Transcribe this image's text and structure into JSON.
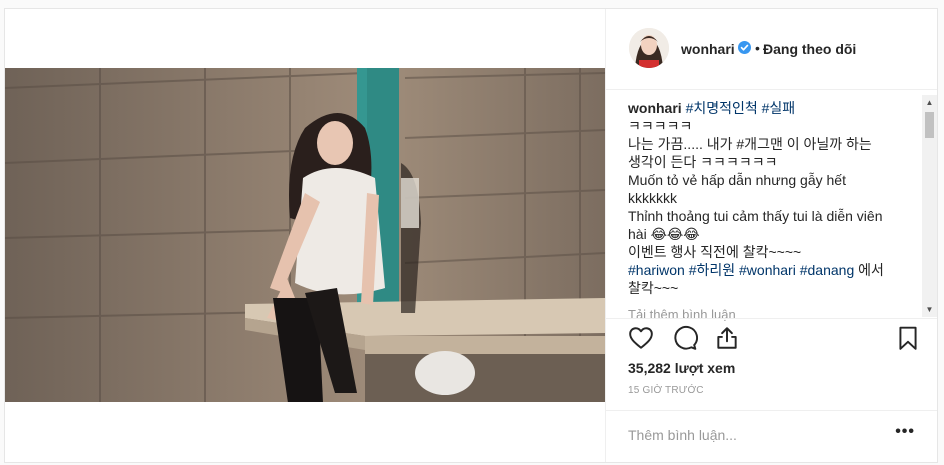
{
  "post": {
    "username": "wonhari",
    "follow_status": "Đang theo dõi",
    "separator": "•"
  },
  "caption": {
    "username": "wonhari",
    "tags_line1": "#치명적인척 #실패",
    "line2": "ㅋㅋㅋㅋㅋ",
    "line3": "나는 가끔..... 내가 #개그맨 이 아닐까 하는",
    "line4": "생각이 든다 ㅋㅋㅋㅋㅋㅋ",
    "line5": "Muốn tỏ vẻ hấp dẫn nhưng gẫy hết",
    "line6": "kkkkkkk",
    "line7": "Thỉnh thoảng tui cảm thấy tui là diễn viên",
    "line8": "hài 😂😂😂",
    "line9": "이벤트 행사 직전에 찰칵~~~~",
    "line10_tags": "#hariwon #하리원 #wonhari #danang",
    "line10_tail": " 에서",
    "line11": "찰칵~~~"
  },
  "load_more_comments": "Tải thêm bình luận",
  "views": "35,282 lượt xem",
  "timestamp": "15 GIỜ TRƯỚC",
  "comment_placeholder": "Thêm bình luận...",
  "more_options": "•••",
  "icons": {
    "like": "heart-icon",
    "comment": "comment-icon",
    "share": "share-icon",
    "save": "bookmark-icon",
    "verified": "verified-badge-icon"
  },
  "colors": {
    "verified": "#3897f0",
    "text": "#262626",
    "secondary": "#999999",
    "hashtag": "#003569"
  }
}
